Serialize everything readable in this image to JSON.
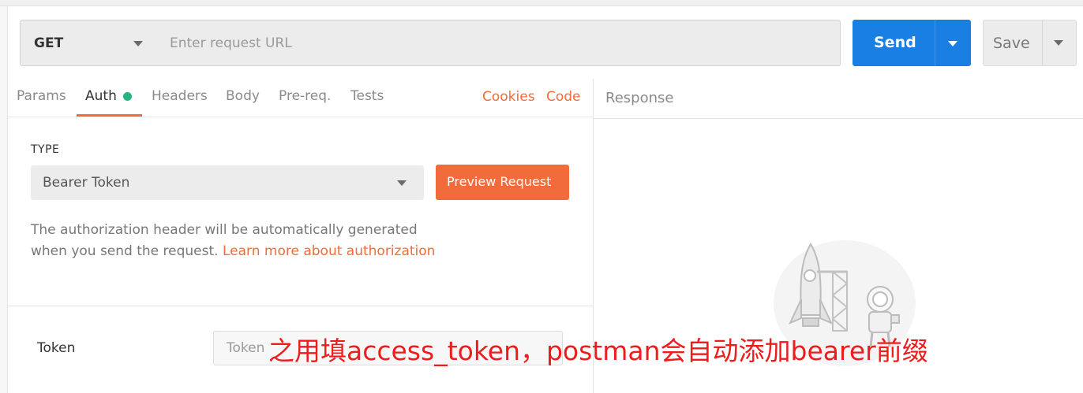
{
  "request": {
    "method": "GET",
    "url_placeholder": "Enter request URL",
    "send_label": "Send",
    "save_label": "Save"
  },
  "tabs": [
    {
      "label": "Params"
    },
    {
      "label": "Auth"
    },
    {
      "label": "Headers"
    },
    {
      "label": "Body"
    },
    {
      "label": "Pre-req."
    },
    {
      "label": "Tests"
    }
  ],
  "active_tab": "Auth",
  "links": {
    "cookies": "Cookies",
    "code": "Code"
  },
  "response": {
    "title": "Response"
  },
  "auth": {
    "type_label": "TYPE",
    "type_value": "Bearer Token",
    "preview_label": "Preview Request",
    "description": "The authorization header will be automatically generated when you send the request.",
    "learn_more": "Learn more about authorization",
    "token_label": "Token",
    "token_placeholder": "Token"
  },
  "annotation": "之用填access_token，postman会自动添加bearer前缀",
  "colors": {
    "accent_orange": "#f26b3a",
    "send_blue": "#1a7fe3",
    "auth_dot_green": "#26b47f",
    "annotation_red": "#ee1c1c"
  }
}
